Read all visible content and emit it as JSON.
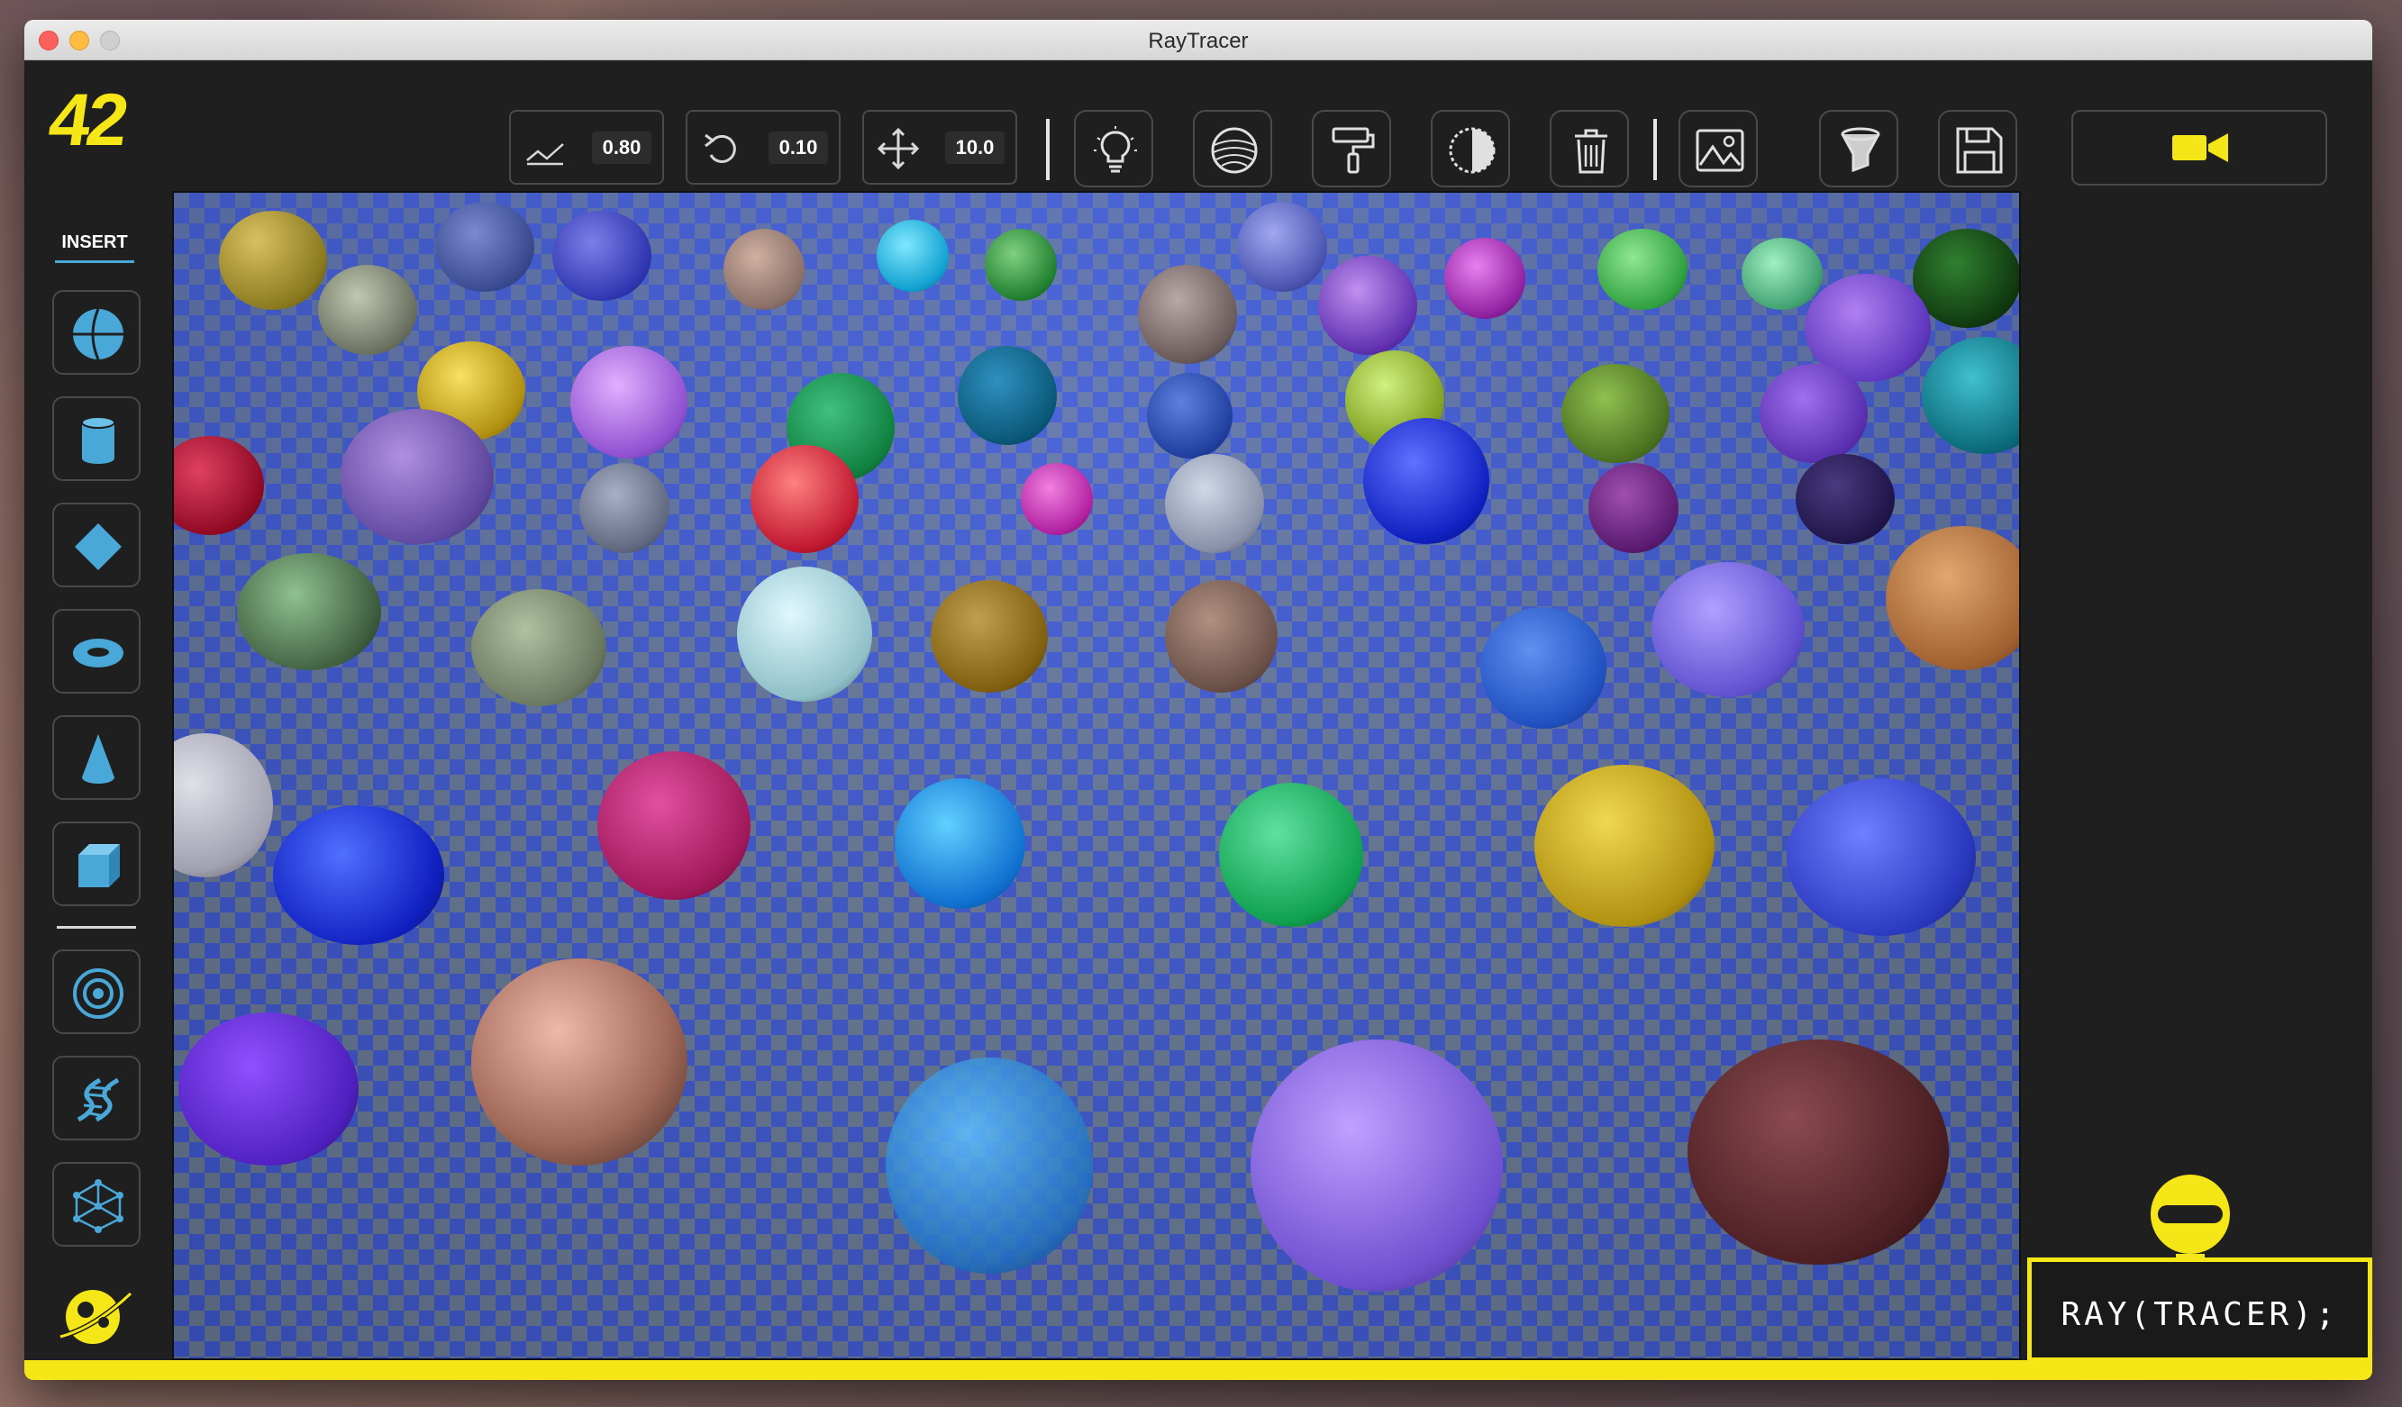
{
  "window": {
    "title": "RayTracer"
  },
  "toolbar": {
    "logo": "42",
    "reflect_value": "0.80",
    "rotate_value": "0.10",
    "move_value": "10.0"
  },
  "sidebar": {
    "insert_label": "INSERT"
  },
  "status": {
    "label": "RAY(TRACER);"
  },
  "colors": {
    "accent": "#f5e617",
    "ui_blue": "#4aa8d8",
    "panel": "#1f1f1f"
  },
  "icons": {
    "toolbar": [
      "reflect-icon",
      "rotate-icon",
      "move-icon",
      "light-bulb-icon",
      "texture-sphere-icon",
      "paint-roller-icon",
      "contrast-icon",
      "trash-icon",
      "image-icon",
      "funnel-filter-icon",
      "save-icon",
      "video-camera-icon"
    ],
    "sidebar": [
      "sphere-icon",
      "cylinder-icon",
      "plane-diamond-icon",
      "torus-icon",
      "cone-icon",
      "cube-icon",
      "orbit-icon",
      "helix-icon",
      "mesh-icon",
      "planet-logo-icon"
    ]
  }
}
